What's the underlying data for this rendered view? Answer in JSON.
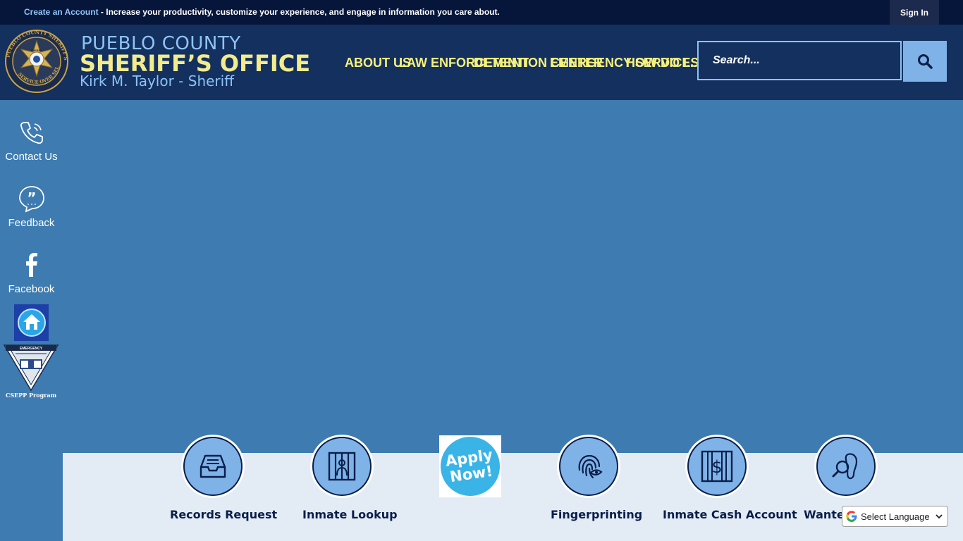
{
  "topbar": {
    "create_account_link": "Create an Account",
    "message": " - Increase your productivity, customize your experience, and engage in information you care about.",
    "sign_in": "Sign In"
  },
  "header": {
    "logo_text": {
      "ring_left": "PUEBLO COUNTY SHERIFF'S OFFICE",
      "ring_bottom": "SERVICE OVER SELF",
      "center": "SHERIFF"
    },
    "line1": "PUEBLO COUNTY",
    "line2": "SHERIFF’S OFFICE",
    "line3": "Kirk M. Taylor - Sheriff"
  },
  "nav": {
    "items": [
      {
        "label": "ABOUT US"
      },
      {
        "label": "LAW ENFORCEMENT"
      },
      {
        "label": "DETENTION CENTER"
      },
      {
        "label": "EMERGENCY SERVICES"
      },
      {
        "label": "HOW DO I..."
      }
    ]
  },
  "search": {
    "placeholder": "Search...",
    "icon": "search-icon"
  },
  "sidebar": {
    "items": [
      {
        "label": "Contact Us",
        "icon": "phone-icon"
      },
      {
        "label": "Feedback",
        "icon": "quote-bubble-icon"
      },
      {
        "label": "Facebook",
        "icon": "facebook-icon"
      }
    ],
    "home_icon": "home-icon",
    "csepp_caption": "CSEPP Program",
    "csepp_badge_text": "EMERGENCY"
  },
  "quick_links": [
    {
      "label": "Records Request",
      "icon": "inbox-tray-icon"
    },
    {
      "label": "Inmate Lookup",
      "icon": "jail-bars-icon"
    },
    {
      "label": "Apply Now!",
      "line1": "Apply",
      "line2": "Now!"
    },
    {
      "label": "Fingerprinting",
      "icon": "fingerprint-icon"
    },
    {
      "label": "Inmate Cash Account",
      "icon": "dollar-bars-icon"
    },
    {
      "label": "Wanted",
      "icon": "magnifier-footprint-icon"
    }
  ],
  "language": {
    "label": "Select Language"
  },
  "colors": {
    "topbar_bg": "#06163a",
    "header_bg": "#13305f",
    "accent_yellow": "#f7f07a",
    "accent_blue": "#8fc3f5",
    "hero_bg": "#3d7bb0",
    "bottom_bg": "#e3ecf5"
  }
}
